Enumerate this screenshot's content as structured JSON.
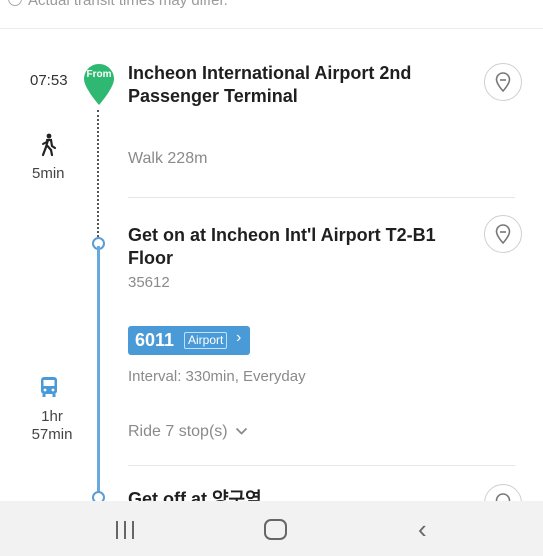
{
  "header_notice": {
    "text": "Actual transit times may differ."
  },
  "start": {
    "time": "07:53",
    "badge": "From",
    "title": "Incheon International Airport 2nd Passenger Terminal"
  },
  "walk": {
    "duration": "5min",
    "text": "Walk 228m"
  },
  "board": {
    "title": "Get on at Incheon Int'l Airport T2-B1 Floor",
    "stop_id": "35612"
  },
  "bus": {
    "number": "6011",
    "type": "Airport",
    "arrow": "›",
    "color": "#4a9ad8",
    "interval": "Interval: 330min, Everyday",
    "ride_duration": "1hr 57min",
    "ride_stops": "Ride 7 stop(s)"
  },
  "alight": {
    "title": "Get off at 양구역"
  },
  "colors": {
    "from_pin": "#2eb872",
    "route_line": "#6aa9de"
  },
  "icons": [
    "walk-icon",
    "bus-icon",
    "location-pin-icon",
    "chevron-down-icon"
  ],
  "navbar": {
    "recent": "recent-apps",
    "home": "home",
    "back": "back"
  }
}
